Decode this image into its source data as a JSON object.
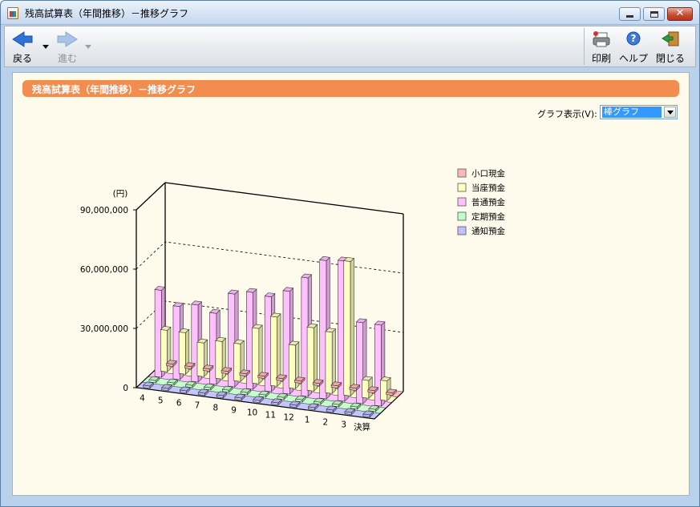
{
  "window": {
    "title": "残高試算表（年間推移）－推移グラフ"
  },
  "toolbar": {
    "back_label": "戻る",
    "forward_label": "進む",
    "print_label": "印刷",
    "help_label": "ヘルプ",
    "close_label": "閉じる"
  },
  "panel": {
    "header": "残高試算表（年間推移）－推移グラフ",
    "graph_display_label": "グラフ表示(V):",
    "graph_type_selected": "棒グラフ"
  },
  "colors": {
    "header_bar": "#f28c4f",
    "content_bg": "#fffbec"
  },
  "chart_data": {
    "type": "bar",
    "ylabel": "(円)",
    "ylim": [
      0,
      90000000
    ],
    "yticks": [
      "90,000,000",
      "60,000,000",
      "30,000,000",
      "0"
    ],
    "categories": [
      "4",
      "5",
      "6",
      "7",
      "8",
      "9",
      "10",
      "11",
      "12",
      "1",
      "2",
      "3",
      "決算"
    ],
    "legend_position": "right",
    "series": [
      {
        "name": "小口現金",
        "color": "#ffb8b8",
        "values": [
          0,
          0,
          0,
          0,
          0,
          0,
          0,
          0,
          0,
          0,
          0,
          0,
          0
        ]
      },
      {
        "name": "当座預金",
        "color": "#ffffc0",
        "values": [
          21000000,
          21000000,
          17000000,
          19000000,
          19000000,
          28000000,
          35000000,
          22000000,
          32000000,
          31000000,
          68000000,
          9000000,
          10000000
        ]
      },
      {
        "name": "普通預金",
        "color": "#ffc0ff",
        "values": [
          44000000,
          37000000,
          39000000,
          36000000,
          47000000,
          49000000,
          48000000,
          52000000,
          60000000,
          70000000,
          71000000,
          41000000,
          41000000
        ]
      },
      {
        "name": "定期預金",
        "color": "#c0ffc8",
        "values": [
          0,
          0,
          0,
          0,
          0,
          0,
          0,
          0,
          0,
          0,
          0,
          0,
          0
        ]
      },
      {
        "name": "通知預金",
        "color": "#c0c0ff",
        "values": [
          0,
          0,
          0,
          0,
          0,
          0,
          0,
          0,
          0,
          0,
          0,
          0,
          0
        ]
      }
    ]
  }
}
